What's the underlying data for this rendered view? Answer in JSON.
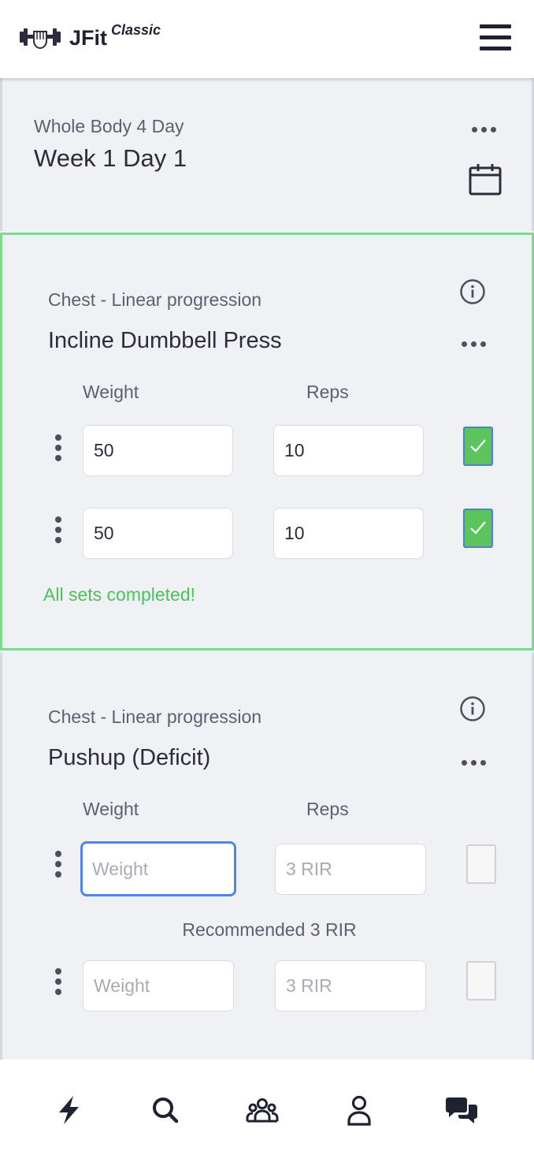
{
  "header": {
    "brand": "JFit",
    "brand_sup": "Classic",
    "icons": {
      "logo": "dumbbell-fist-icon",
      "menu": "hamburger-menu-icon"
    }
  },
  "workout": {
    "program_name": "Whole Body 4 Day",
    "day_title": "Week 1 Day 1",
    "icons": {
      "more": "more-horizontal-icon",
      "calendar": "calendar-icon"
    }
  },
  "exercises": [
    {
      "muscle": "Chest - Linear progression",
      "name": "Incline Dumbbell Press",
      "weight_label": "Weight",
      "reps_label": "Reps",
      "sets": [
        {
          "weight": "50",
          "reps": "10",
          "weight_placeholder": "",
          "reps_placeholder": "",
          "completed": true
        },
        {
          "weight": "50",
          "reps": "10",
          "weight_placeholder": "",
          "reps_placeholder": "",
          "completed": true
        }
      ],
      "status": "All sets completed!",
      "accent": "#7fd88f"
    },
    {
      "muscle": "Chest - Linear progression",
      "name": "Pushup (Deficit)",
      "weight_label": "Weight",
      "reps_label": "Reps",
      "sets": [
        {
          "weight": "",
          "reps": "",
          "weight_placeholder": "Weight",
          "reps_placeholder": "3 RIR",
          "completed": false
        },
        {
          "weight": "",
          "reps": "",
          "weight_placeholder": "Weight",
          "reps_placeholder": "3 RIR",
          "completed": false
        }
      ],
      "recommendation": "Recommended 3 RIR"
    }
  ],
  "bottom_nav": [
    {
      "icon": "lightning-bolt-icon",
      "name": "workout"
    },
    {
      "icon": "search-icon",
      "name": "search"
    },
    {
      "icon": "users-group-icon",
      "name": "community"
    },
    {
      "icon": "user-profile-icon",
      "name": "profile"
    },
    {
      "icon": "chat-bubbles-icon",
      "name": "messages"
    }
  ],
  "colors": {
    "background": "#f0f1f4",
    "completed_green": "#4bc25a",
    "check_fill": "#5cc45c",
    "focus_blue": "#4d84ef"
  }
}
